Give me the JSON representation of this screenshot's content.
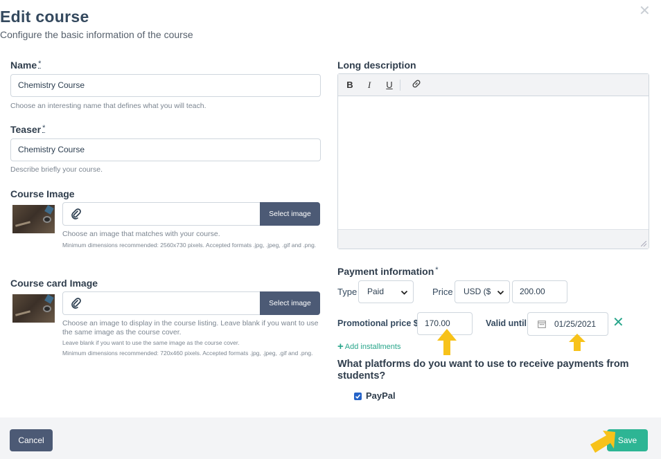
{
  "modal": {
    "title": "Edit course",
    "subtitle": "Configure the basic information of the course",
    "close_icon": "close-icon"
  },
  "name": {
    "label": "Name",
    "required_mark": "*",
    "value": "Chemistry Course",
    "help": "Choose an interesting name that defines what you will teach."
  },
  "teaser": {
    "label": "Teaser",
    "required_mark": "*",
    "value": "Chemistry Course",
    "help": "Describe briefly your course."
  },
  "course_image": {
    "label": "Course Image",
    "button": "Select image",
    "help": "Choose an image that matches with your course.",
    "help_small": "Minimum dimensions recommended: 2560x730 pixels. Accepted formats .jpg, .jpeg, .gif and .png."
  },
  "card_image": {
    "label": "Course card Image",
    "button": "Select image",
    "help": "Choose an image to display in the course listing. Leave blank if you want to use the same image as the course cover.",
    "help_small_1": "Leave blank if you want to use the same image as the course cover.",
    "help_small_2": "Minimum dimensions recommended: 720x460 pixels. Accepted formats .jpg, .jpeg, .gif and .png."
  },
  "long_description": {
    "label": "Long description",
    "toolbar": {
      "bold": "B",
      "italic": "I",
      "underline": "U"
    }
  },
  "payment": {
    "label": "Payment information",
    "required_mark": "*",
    "type_label": "Type",
    "type_value": "Paid",
    "price_label": "Price",
    "currency_value": "USD ($",
    "price_value": "200.00",
    "promo_label": "Promotional price $",
    "promo_value": "170.00",
    "valid_until_label": "Valid until",
    "valid_until_value": "01/25/2021",
    "add_installments": "Add installments"
  },
  "platforms": {
    "question": "What platforms do you want to use to receive payments from students?",
    "paypal_label": "PayPal",
    "paypal_checked": true
  },
  "footer": {
    "cancel": "Cancel",
    "save": "Save"
  },
  "colors": {
    "primary_dark": "#4c5a75",
    "success": "#2db594",
    "highlight_arrow": "#f7c21a"
  }
}
